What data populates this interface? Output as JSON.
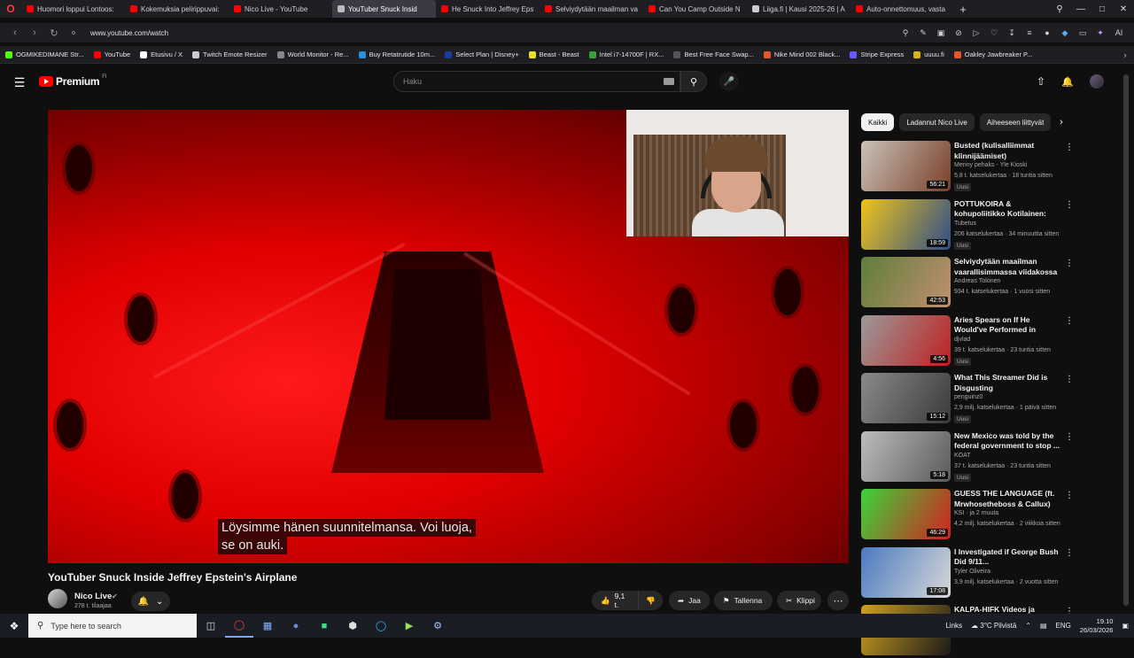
{
  "browser": {
    "tabs": [
      {
        "label": "Huomori loppui Lontoos:",
        "color": "#ff0000"
      },
      {
        "label": "Kokemuksia pelirippuvai:",
        "color": "#ff0000"
      },
      {
        "label": "Nico Live - YouTube",
        "color": "#ff0000"
      },
      {
        "label": "YouTuber Snuck Insid",
        "color": "#bbbbbb",
        "active": true
      },
      {
        "label": "He Snuck Into Jeffrey Epst",
        "color": "#ff0000"
      },
      {
        "label": "Selviydytään maailman va",
        "color": "#ff0000"
      },
      {
        "label": "Can You Camp Outside N",
        "color": "#ff0000"
      },
      {
        "label": "Liiga.fi | Kausi 2025-26 | A",
        "color": "#cccccc"
      },
      {
        "label": "Auto-onnettomuus, vasta",
        "color": "#ff0000"
      }
    ],
    "url": "www.youtube.com/watch",
    "bookmarks": [
      {
        "label": "OGMIKEDIMANE Str...",
        "color": "#53fc18"
      },
      {
        "label": "YouTube",
        "color": "#ff0000"
      },
      {
        "label": "Etusivu / X",
        "color": "#ffffff"
      },
      {
        "label": "Twitch Emote Resizer",
        "color": "#cccccc"
      },
      {
        "label": "World Monitor - Re...",
        "color": "#888888"
      },
      {
        "label": "Buy Retatrutide 10m...",
        "color": "#2b8fd9"
      },
      {
        "label": "Select Plan | Disney+",
        "color": "#1a3c9a"
      },
      {
        "label": "Beast - Beast",
        "color": "#e8e020"
      },
      {
        "label": "Intel i7-14700F | RX...",
        "color": "#36a33a"
      },
      {
        "label": "Best Free Face Swap...",
        "color": "#555555"
      },
      {
        "label": "Nike Mind 002 Black...",
        "color": "#e05a2a"
      },
      {
        "label": "Stripe Express",
        "color": "#635bff"
      },
      {
        "label": "uuuu.fi",
        "color": "#d9b31a"
      },
      {
        "label": "Oakley Jawbreaker P...",
        "color": "#e4572e"
      }
    ]
  },
  "youtube": {
    "logo_text": "Premium",
    "logo_country": "FI",
    "search_placeholder": "Haku",
    "subtitle_line1": "Löysimme hänen suunnitelmansa.  Voi luoja,",
    "subtitle_line2": "se on auki.",
    "video_title": "YouTuber Snuck Inside Jeffrey Epstein's Airplane",
    "channel_name": "Nico Live",
    "subscribers": "278 t. tilaajaa",
    "like_count": "9,1 t.",
    "share_label": "Jaa",
    "save_label": "Tallenna",
    "clip_label": "Klippi",
    "chips": [
      "Kaikki",
      "Ladannut Nico Live",
      "Aiheeseen liittyvät"
    ],
    "recommendations": [
      {
        "title": "Busted (kulisalliimmat klinnijäämiset)",
        "channel": "Menny pehaks - Yle Kioski",
        "meta": "5,8 t. katselukertaa · 18 tuntia sitten",
        "badge": "Uusi",
        "duration": "56:21",
        "thumb_a": "#c9c2b8",
        "thumb_b": "#7a3f2a"
      },
      {
        "title": "POTTUKOIRA & kohupoliitikko Kotilainen: Ongelmia ...",
        "channel": "Tubetus",
        "meta": "206 katselukertaa · 34 minuuttia sitten",
        "badge": "Uusi",
        "duration": "18:59",
        "thumb_a": "#f0c419",
        "thumb_b": "#2f4e8a"
      },
      {
        "title": "Selviydytään maailman vaarallisimmassa viidakossa",
        "channel": "Andreas Tolonen",
        "meta": "934 t. katselukertaa · 1 vuosi sitten",
        "badge": "",
        "duration": "42:53",
        "thumb_a": "#5f7d3a",
        "thumb_b": "#c09070"
      },
      {
        "title": "Aries Spears on If He Would've Performed in Apartheid South...",
        "channel": "djvlad",
        "meta": "39 t. katselukertaa · 23 tuntia sitten",
        "badge": "Uusi",
        "duration": "4:56",
        "thumb_a": "#9a9a9a",
        "thumb_b": "#c02020"
      },
      {
        "title": "What This Streamer Did is Disgusting",
        "channel": "penguinz0",
        "meta": "2,9 milj. katselukertaa · 1 päivä sitten",
        "badge": "Uusi",
        "duration": "15:12",
        "thumb_a": "#8a8a8a",
        "thumb_b": "#3a3a3a"
      },
      {
        "title": "New Mexico was told by the federal government to stop ...",
        "channel": "KOAT",
        "meta": "37 t. katselukertaa · 23 tuntia sitten",
        "badge": "Uusi",
        "duration": "5:18",
        "thumb_a": "#bcbcbc",
        "thumb_b": "#5a5a5a"
      },
      {
        "title": "GUESS THE LANGUAGE (ft. Mrwhosetheboss & Callux)",
        "channel": "KSI · ja 2 muuta",
        "meta": "4,2 milj. katselukertaa · 2 viikkoa sitten",
        "badge": "",
        "duration": "46:29",
        "thumb_a": "#3ad43a",
        "thumb_b": "#d42020"
      },
      {
        "title": "I Investigated if George Bush Did 9/11...",
        "channel": "Tyler Oliveira",
        "meta": "3,9 milj. katselukertaa · 2 vuotta sitten",
        "badge": "",
        "duration": "17:08",
        "thumb_a": "#4a7ac0",
        "thumb_b": "#d8d8d8"
      },
      {
        "title": "KALPA-HIFK Videos ja ratkaiseva osa. Livesuuraita",
        "channel": "",
        "meta": "",
        "badge": "",
        "duration": "",
        "thumb_a": "#d0a020",
        "thumb_b": "#1a1a1a"
      }
    ]
  },
  "taskbar": {
    "search_placeholder": "Type here to search",
    "links_label": "Links",
    "weather": "3°C  Pilvistä",
    "language": "ENG",
    "time": "19.10",
    "date": "26/03/2026"
  }
}
